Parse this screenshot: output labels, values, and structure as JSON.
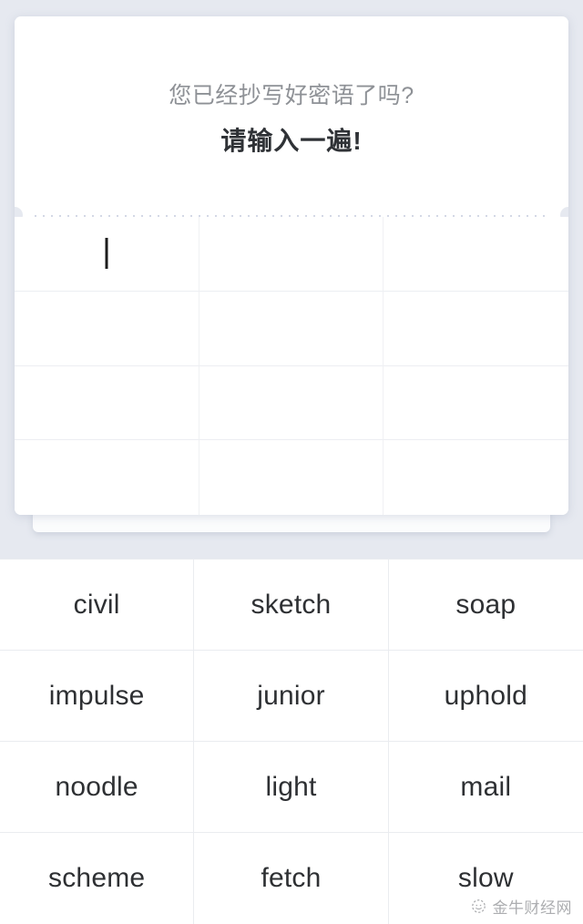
{
  "theme": {
    "page_background": "#e6e9f0",
    "card_background": "#ffffff",
    "prompt_muted_color": "#8e9196",
    "prompt_strong_color": "#2f3236",
    "grid_line_color": "#eaecf0",
    "caret_color": "#1c1c1c",
    "word_text_color": "#2e3033"
  },
  "card": {
    "prompt": {
      "question": "您已经抄写好密语了吗?",
      "instruction": "请输入一遍!"
    },
    "perforation": {
      "notch_left": "tear-notch-left",
      "notch_right": "tear-notch-right"
    },
    "input_grid": {
      "columns": 3,
      "rows": 4,
      "cells": [
        "",
        "",
        "",
        "",
        "",
        "",
        "",
        "",
        "",
        "",
        "",
        ""
      ],
      "active_cell_index": 0,
      "caret_visible": true
    }
  },
  "word_bank": {
    "columns": 3,
    "rows": 4,
    "words": [
      "civil",
      "sketch",
      "soap",
      "impulse",
      "junior",
      "uphold",
      "noodle",
      "light",
      "mail",
      "scheme",
      "fetch",
      "slow"
    ]
  },
  "watermark": {
    "icon": "wechat-circle-logo-icon",
    "text": "金牛财经网"
  }
}
